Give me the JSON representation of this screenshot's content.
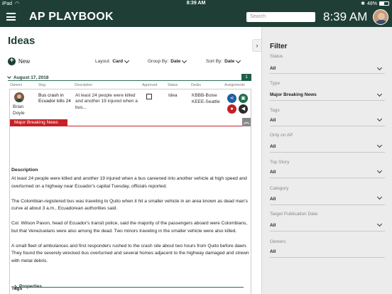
{
  "statusbar": {
    "carrier": "iPad",
    "time": "8:39 AM",
    "battery": "48%"
  },
  "appbar": {
    "brand": "AP PLAYBOOK",
    "search_placeholder": "Search",
    "clock": "8:39 AM"
  },
  "main": {
    "title": "Ideas",
    "new_label": "New",
    "layout_label": "Layout:",
    "layout_value": "Card",
    "groupby_label": "Group By:",
    "groupby_value": "Date",
    "sortby_label": "Sort By:",
    "sortby_value": "Date",
    "group_date": "August 17, 2018",
    "group_count": "1",
    "columns": [
      "Owners",
      "Slug",
      "Description",
      "Approved",
      "Status",
      "Desks",
      "Assignments"
    ]
  },
  "card": {
    "owner_name": "Brian Doyle",
    "slug": "Bus crash in Ecuador kills 24",
    "desc_short": "At least 24 people were killed and another 19 injured when a bus...",
    "status": "Idea",
    "desks": [
      "KBBB-Boise",
      "KEEE-Seattle"
    ],
    "category_tag": "Major Breaking News",
    "description_label": "Description",
    "paragraphs": [
      "At least 24 people were killed and another 19 injured when a bus careened into another vehicle at high speed and overturned on a highway near Ecuador's capital Tuesday, officials reported.",
      "The Colombian-registered bus was traveling to Quito when it hit a smaller vehicle in an area known as dead man's curve at about 3 a.m., Ecuadorean authorities said.",
      "Col. Wilson Pavon, head of Ecuador's transit police, said the majority of the passengers aboard were Colombians, but that Venezuelans were also among the dead. Two minors traveling in the smaller vehicle were also killed.",
      "A small fleet of ambulances and first responders rushed to the crash site about two hours from Quito before dawn. They found the severely wrecked bus overturned and several homes adjacent to the highway damaged and strewn with metal debris."
    ],
    "tags_label": "Tags",
    "tag_add": "+",
    "properties_label": "Properties"
  },
  "filter": {
    "title": "Filter",
    "fields": [
      {
        "label": "Status",
        "value": "All"
      },
      {
        "label": "Type",
        "value": "Major Breaking News"
      },
      {
        "label": "Tags",
        "value": "All"
      },
      {
        "label": "Only on AP",
        "value": "All"
      },
      {
        "label": "Top Story",
        "value": "All"
      },
      {
        "label": "Category",
        "value": "All"
      },
      {
        "label": "Target Publication Date",
        "value": "All"
      },
      {
        "label": "Owners",
        "value": "All"
      }
    ]
  }
}
